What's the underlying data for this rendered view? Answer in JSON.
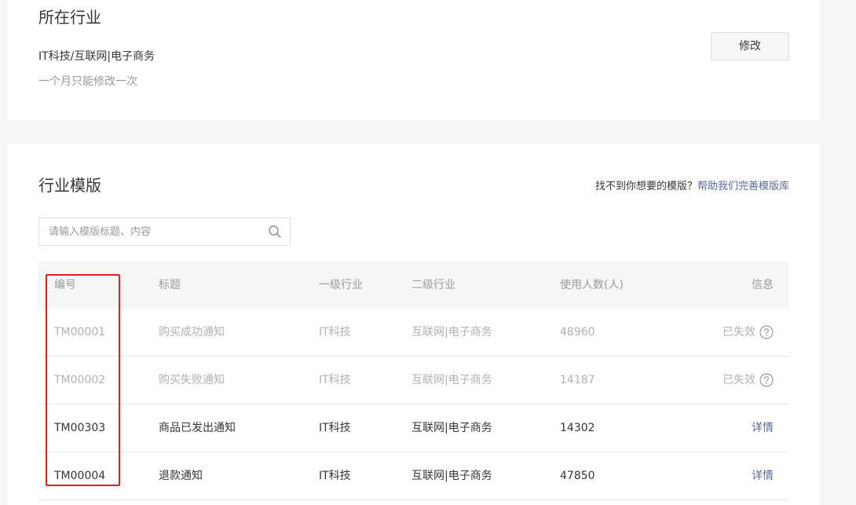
{
  "industry": {
    "title": "所在行业",
    "value": "IT科技/互联网|电子商务",
    "note": "一个月只能修改一次",
    "modify_label": "修改"
  },
  "templates": {
    "title": "行业模版",
    "help_text": "找不到你想要的模版？",
    "help_link": "帮助我们完善模版库",
    "search": {
      "placeholder": "请输入模版标题、内容",
      "value": ""
    },
    "columns": [
      "编号",
      "标题",
      "一级行业",
      "二级行业",
      "使用人数(人)",
      "信息"
    ],
    "rows": [
      {
        "id": "TM00001",
        "title": "购买成功通知",
        "level1": "IT科技",
        "level2": "互联网|电子商务",
        "users": "48960",
        "info": "已失效",
        "status": "disabled"
      },
      {
        "id": "TM00002",
        "title": "购买失败通知",
        "level1": "IT科技",
        "level2": "互联网|电子商务",
        "users": "14187",
        "info": "已失效",
        "status": "disabled"
      },
      {
        "id": "TM00303",
        "title": "商品已发出通知",
        "level1": "IT科技",
        "level2": "互联网|电子商务",
        "users": "14302",
        "info": "详情",
        "status": "active"
      },
      {
        "id": "TM00004",
        "title": "退款通知",
        "level1": "IT科技",
        "level2": "互联网|电子商务",
        "users": "47850",
        "info": "详情",
        "status": "active"
      }
    ]
  },
  "colors": {
    "link": "#576b95",
    "muted": "#9a9a9a",
    "disabled": "#b2b2b2",
    "highlight": "#e02020"
  },
  "icons": {
    "search": "search-icon",
    "help": "help-circle-icon"
  }
}
